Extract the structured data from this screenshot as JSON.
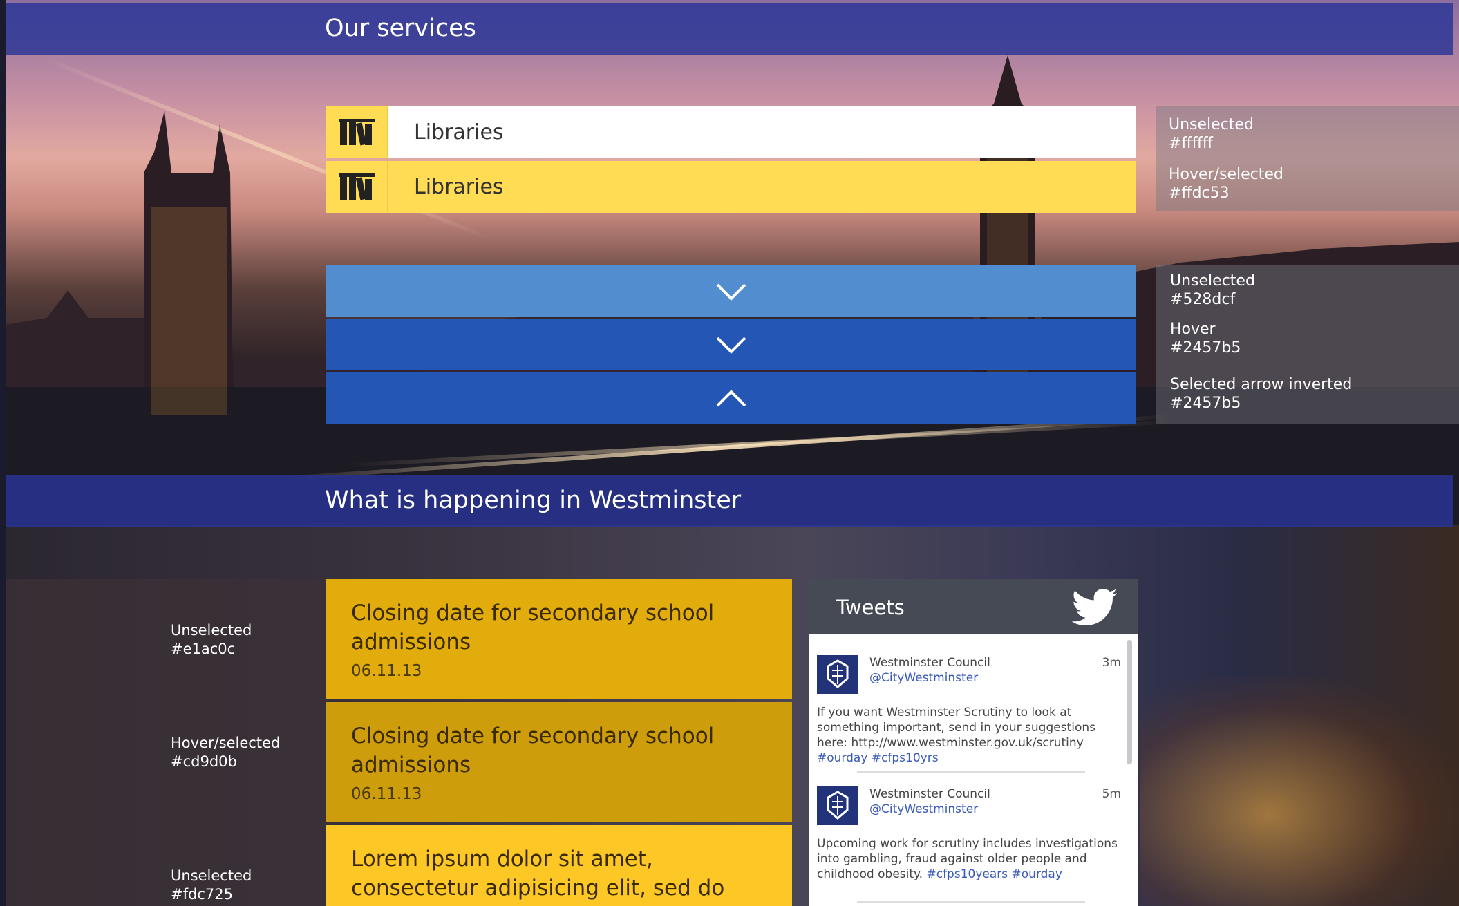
{
  "colors": {
    "unselected_white": "#ffffff",
    "hover_yellow": "#ffdc53",
    "arrow_unselected": "#528dcf",
    "arrow_hover": "#2457b5",
    "news_unselected": "#e1ac0c",
    "news_hover": "#cd9d0b",
    "news_unselected_alt": "#fdc725",
    "header_blue": "#283496"
  },
  "services": {
    "heading": "Our services",
    "items": [
      {
        "label": "Libraries",
        "icon": "library-books-icon",
        "state": "unselected"
      },
      {
        "label": "Libraries",
        "icon": "library-books-icon",
        "state": "hover"
      }
    ],
    "notes": [
      {
        "label": "Unselected",
        "value": "#ffffff"
      },
      {
        "label": "Hover/selected",
        "value": "#ffdc53"
      }
    ],
    "arrows": [
      {
        "icon": "chevron-down-icon",
        "state": "unselected"
      },
      {
        "icon": "chevron-down-icon",
        "state": "hover"
      },
      {
        "icon": "chevron-up-icon",
        "state": "selected"
      }
    ],
    "arrow_notes": [
      {
        "label": "Unselected",
        "value": "#528dcf"
      },
      {
        "label": "Hover",
        "value": "#2457b5"
      },
      {
        "label": "Selected arrow inverted",
        "value": "#2457b5"
      }
    ]
  },
  "happening": {
    "heading": "What is happening in Westminster",
    "news": [
      {
        "title": "Closing date for secondary school admissions",
        "date": "06.11.13",
        "state": "unselected"
      },
      {
        "title": "Closing date for secondary school admissions",
        "date": "06.11.13",
        "state": "hover"
      },
      {
        "title": "Lorem ipsum dolor sit amet, consectetur adipisicing elit, sed do eiusmod tempor",
        "date": "",
        "state": "unselected-alt"
      }
    ],
    "notes": [
      {
        "label": "Unselected",
        "value": "#e1ac0c"
      },
      {
        "label": "Hover/selected",
        "value": "#cd9d0b"
      },
      {
        "label": "Unselected",
        "value": "#fdc725"
      }
    ]
  },
  "tweets": {
    "title": "Tweets",
    "icon": "twitter-bird-icon",
    "items": [
      {
        "name": "Westminster Council",
        "handle": "@CityWestminster",
        "time": "3m",
        "text": "If you want Westminster Scrutiny to look at something important, send in your suggestions here: http://www.westminster.gov.uk/scrutiny",
        "tags": "#ourday #cfps10yrs"
      },
      {
        "name": "Westminster Council",
        "handle": "@CityWestminster",
        "time": "5m",
        "text": "Upcoming work for scrutiny includes investigations into gambling, fraud against older people and childhood obesity.",
        "tags": "#cfps10years #ourday"
      }
    ]
  }
}
